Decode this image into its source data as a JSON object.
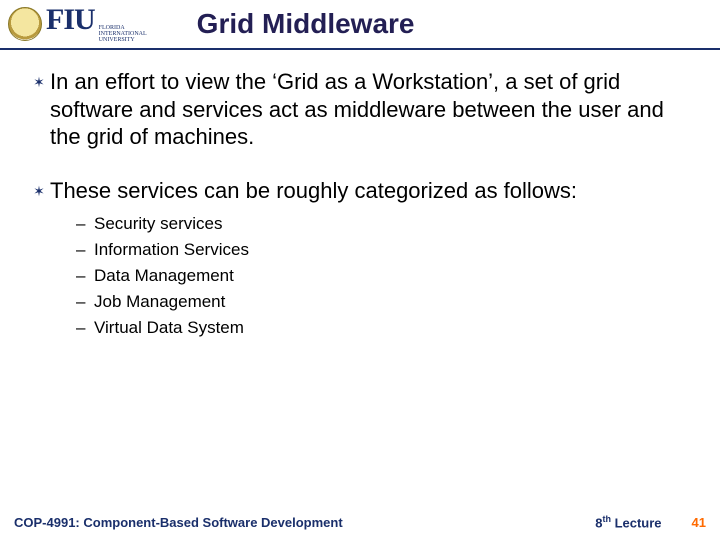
{
  "header": {
    "logo_main": "FIU",
    "logo_side_top": "FLORIDA",
    "logo_side_mid": "INTERNATIONAL",
    "logo_side_bot": "UNIVERSITY",
    "title": "Grid Middleware"
  },
  "bullets": [
    "In an effort to view the ‘Grid as a Workstation’, a set of grid software and services act as middleware between the user and the grid of machines.",
    "These services can be roughly categorized as follows:"
  ],
  "sublist": [
    "Security services",
    "Information Services",
    "Data Management",
    "Job Management",
    "Virtual Data System"
  ],
  "footer": {
    "left": "COP-4991: Component-Based Software Development",
    "center_num": "8",
    "center_ord": "th",
    "center_suffix": " Lecture",
    "right": "41"
  }
}
